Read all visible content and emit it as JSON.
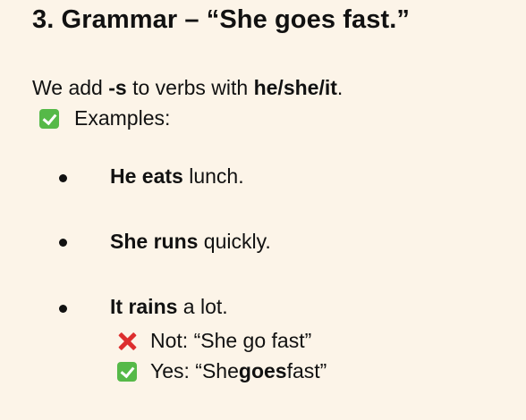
{
  "heading": "3. Grammar – “She goes fast.”",
  "intro": {
    "part1": "We add ",
    "suffix": "-s",
    "part2": " to verbs with ",
    "pronouns": "he/she/it",
    "part3": "."
  },
  "examples_label": "Examples:",
  "icons": {
    "check": "check-mark-icon",
    "cross": "cross-mark-icon",
    "check_color": "#56b948",
    "cross_color": "#dd2e2e"
  },
  "examples": [
    {
      "bold": "He eats",
      "rest": " lunch."
    },
    {
      "bold": "She runs",
      "rest": " quickly."
    },
    {
      "bold": "It rains",
      "rest": " a lot."
    }
  ],
  "wrong": {
    "text": "Not: “She go fast”"
  },
  "right": {
    "before": "Yes: “She ",
    "bold": "goes",
    "after": " fast”"
  },
  "colors": {
    "background": "#fcf4e8",
    "text": "#111111"
  }
}
